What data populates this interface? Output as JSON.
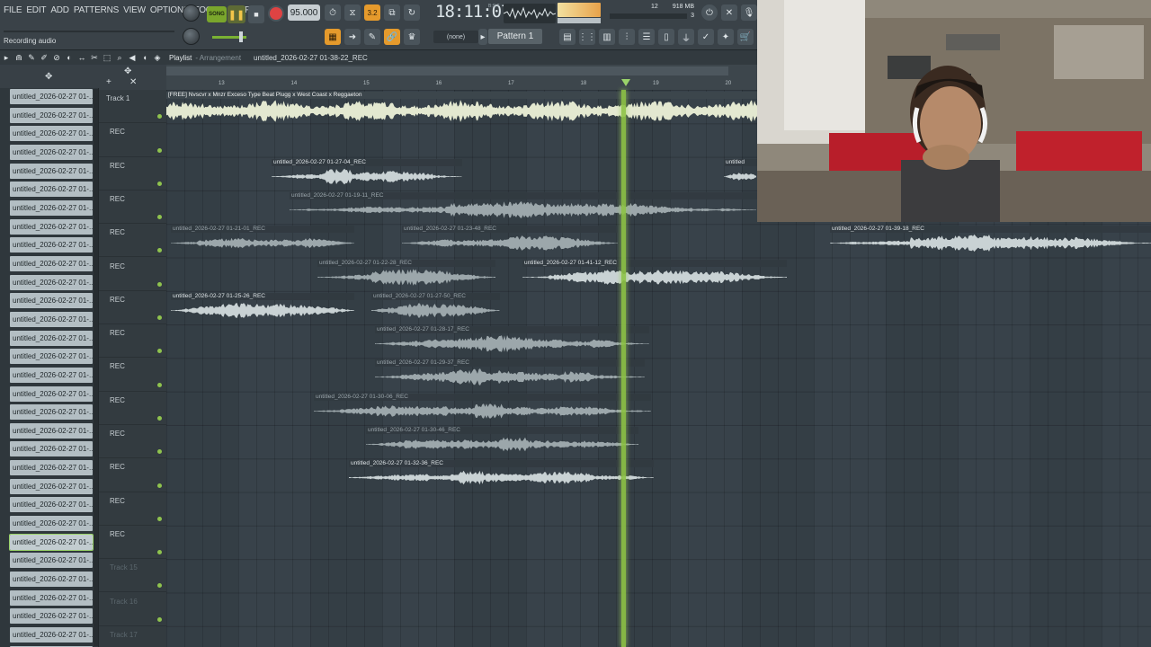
{
  "menu": [
    "FILE",
    "EDIT",
    "ADD",
    "PATTERNS",
    "VIEW",
    "OPTIONS",
    "TOOLS",
    "HELP"
  ],
  "hint_text": "Recording audio",
  "transport": {
    "mode_label": "SONG",
    "tempo": "95.000",
    "time": "18:11:07",
    "time_sub": "B:S:T",
    "step_label": "3.2",
    "cpu_voices": "12",
    "memory": "918 MB",
    "cpu_3": "3"
  },
  "pattern": {
    "selector": "Pattern 1",
    "none_label": "(none)"
  },
  "playlist": {
    "title": "Playlist",
    "subtitle": "- Arrangement",
    "project": "untitled_2026-02-27 01-38-22_REC"
  },
  "ruler_ticks": [
    "13",
    "14",
    "15",
    "16",
    "17",
    "18",
    "19",
    "20"
  ],
  "browser_items": [
    "untitled_2026-02-27 01-...",
    "untitled_2026-02-27 01-...",
    "untitled_2026-02-27 01-...",
    "untitled_2026-02-27 01-...",
    "untitled_2026-02-27 01-...",
    "untitled_2026-02-27 01-...",
    "untitled_2026-02-27 01-...",
    "untitled_2026-02-27 01-...",
    "untitled_2026-02-27 01-...",
    "untitled_2026-02-27 01-...",
    "untitled_2026-02-27 01-...",
    "untitled_2026-02-27 01-...",
    "untitled_2026-02-27 01-...",
    "untitled_2026-02-27 01-...",
    "untitled_2026-02-27 01-...",
    "untitled_2026-02-27 01-...",
    "untitled_2026-02-27 01-...",
    "untitled_2026-02-27 01-...",
    "untitled_2026-02-27 01-...",
    "untitled_2026-02-27 01-...",
    "untitled_2026-02-27 01-...",
    "untitled_2026-02-27 01-...",
    "untitled_2026-02-27 01-...",
    "untitled_2026-02-27 01-...",
    "untitled_2026-02-27 01-...",
    "untitled_2026-02-27 01-...",
    "untitled_2026-02-27 01-...",
    "untitled_2026-02-27 01-...",
    "untitled_2026-02-27 01-...",
    "untitled_2026-02-27 01-...",
    "untitled_2026-02-27 01-..."
  ],
  "browser_selected": 24,
  "tracks": [
    {
      "label": "Track 1"
    },
    {
      "label": "REC"
    },
    {
      "label": "REC"
    },
    {
      "label": "REC"
    },
    {
      "label": "REC"
    },
    {
      "label": "REC"
    },
    {
      "label": "REC"
    },
    {
      "label": "REC"
    },
    {
      "label": "REC"
    },
    {
      "label": "REC"
    },
    {
      "label": "REC"
    },
    {
      "label": "REC"
    },
    {
      "label": "REC"
    },
    {
      "label": "REC"
    },
    {
      "label": "Track 15"
    },
    {
      "label": "Track 16"
    },
    {
      "label": "Track 17"
    }
  ],
  "clips": [
    {
      "row": 0,
      "start": 0.0,
      "len": 657,
      "name": "[FREE] Nvscvr x Mnzr Exceso Type Beat  Plugg x West Coast x Reggaeton",
      "bright": true,
      "master": true
    },
    {
      "row": 2,
      "start": 117,
      "len": 212,
      "name": "untitled_2026-02-27 01-27-04_REC",
      "bright": true
    },
    {
      "row": 2,
      "start": 620,
      "len": 37,
      "name": "untitled",
      "bright": true
    },
    {
      "row": 3,
      "start": 137,
      "len": 520,
      "name": "untitled_2026-02-27 01-19-11_REC",
      "bright": false
    },
    {
      "row": 4,
      "start": 5,
      "len": 204,
      "name": "untitled_2026-02-27 01-21-01_REC",
      "bright": false
    },
    {
      "row": 4,
      "start": 262,
      "len": 240,
      "name": "untitled_2026-02-27 01-23-48_REC",
      "bright": false
    },
    {
      "row": 4,
      "start": 738,
      "len": 357,
      "name": "untitled_2026-02-27 01-39-18_REC",
      "bright": true
    },
    {
      "row": 5,
      "start": 168,
      "len": 198,
      "name": "untitled_2026-02-27 01-22-28_REC",
      "bright": false
    },
    {
      "row": 5,
      "start": 396,
      "len": 294,
      "name": "untitled_2026-02-27 01-41-12_REC",
      "bright": true
    },
    {
      "row": 6,
      "start": 5,
      "len": 204,
      "name": "untitled_2026-02-27 01-25-26_REC",
      "bright": true
    },
    {
      "row": 6,
      "start": 228,
      "len": 143,
      "name": "untitled_2026-02-27 01-27-50_REC",
      "bright": false
    },
    {
      "row": 7,
      "start": 232,
      "len": 305,
      "name": "untitled_2026-02-27 01-28-17_REC",
      "bright": false
    },
    {
      "row": 8,
      "start": 232,
      "len": 300,
      "name": "untitled_2026-02-27 01-29-37_REC",
      "bright": false
    },
    {
      "row": 9,
      "start": 164,
      "len": 375,
      "name": "untitled_2026-02-27 01-30-06_REC",
      "bright": false
    },
    {
      "row": 10,
      "start": 222,
      "len": 303,
      "name": "untitled_2026-02-27 01-30-46_REC",
      "bright": false
    },
    {
      "row": 11,
      "start": 203,
      "len": 339,
      "name": "untitled_2026-02-27 01-32-36_REC",
      "bright": true
    }
  ],
  "colors": {
    "accent": "#8ec446",
    "record": "#de4343",
    "wave": "#c9d2d4",
    "wave_dim": "#9ca7ab",
    "master_wave": "#e3e8d0"
  }
}
